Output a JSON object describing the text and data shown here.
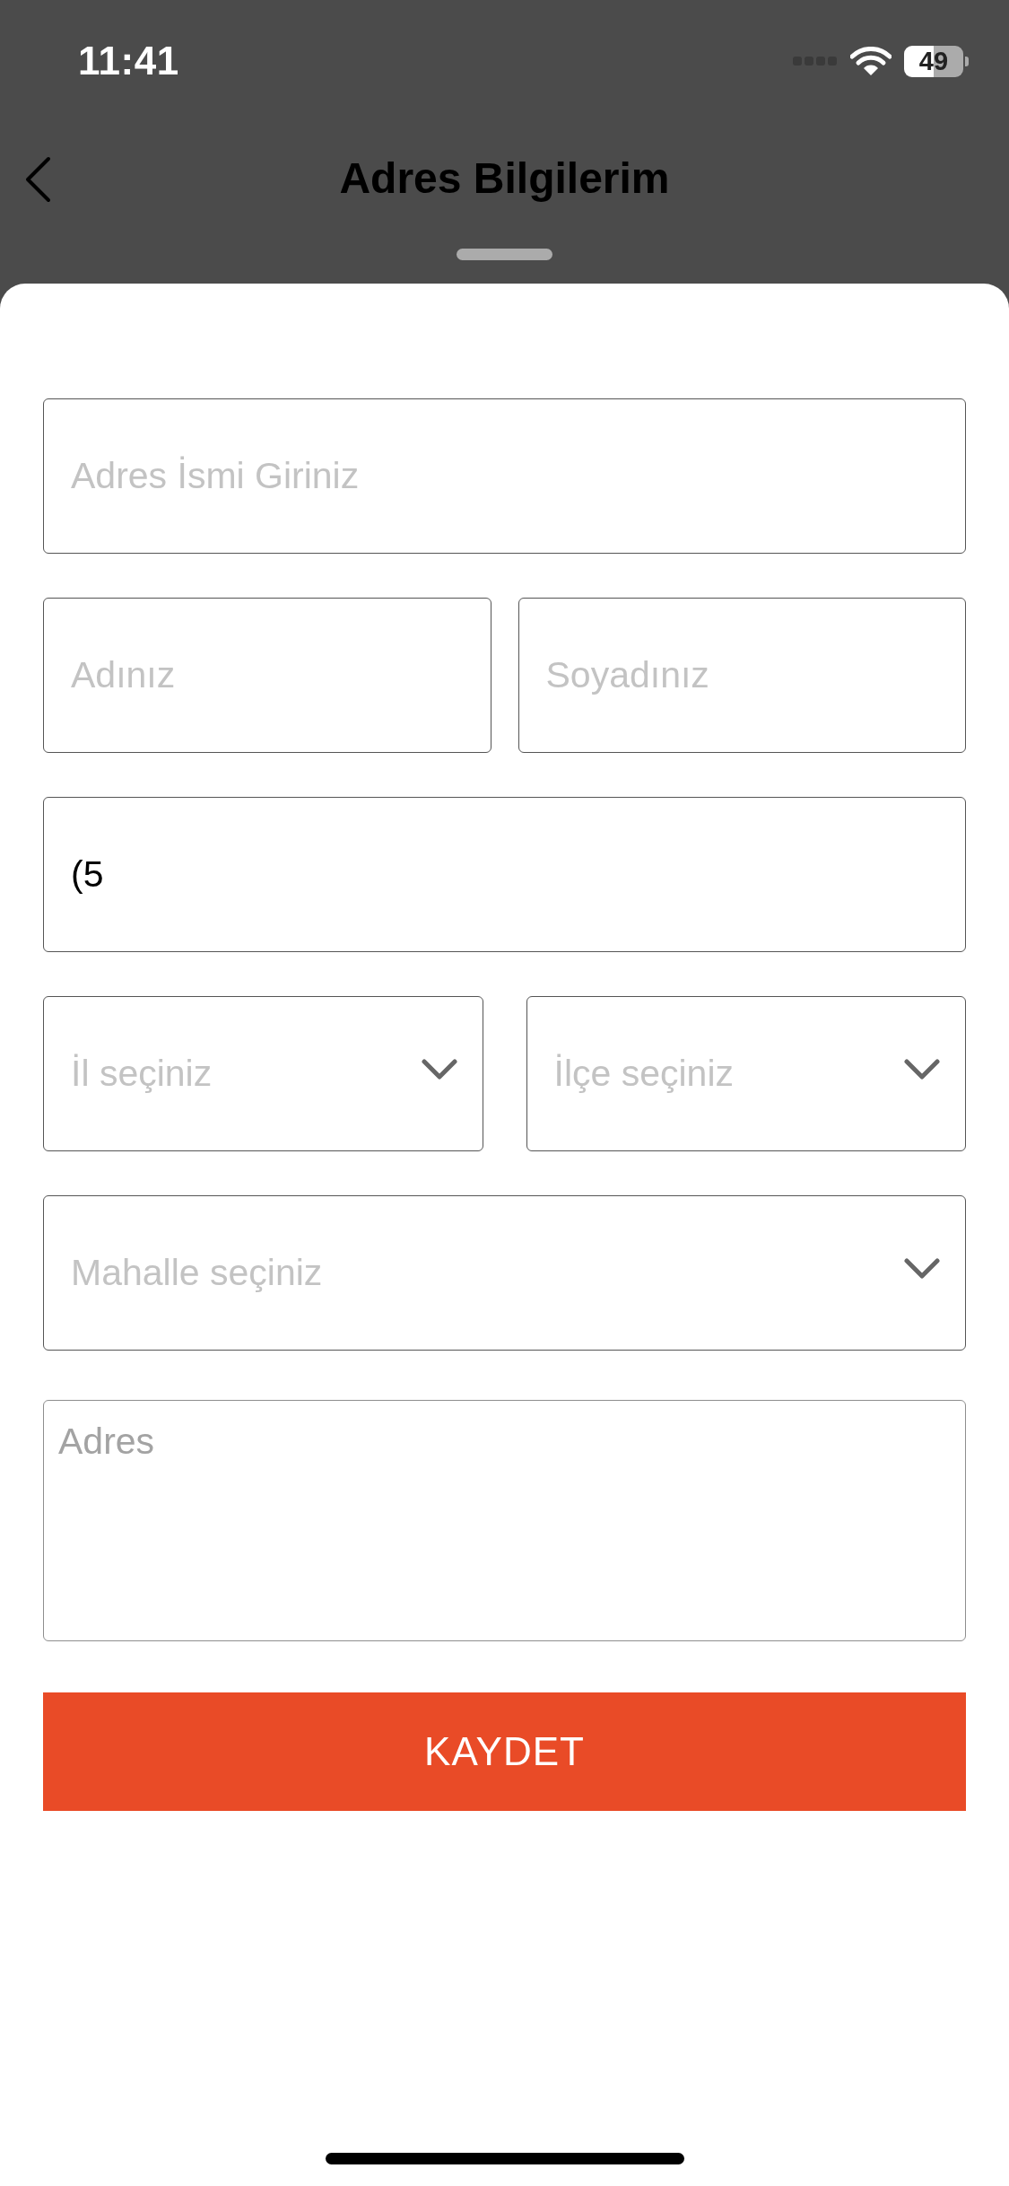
{
  "status_bar": {
    "time": "11:41",
    "battery": "49"
  },
  "header": {
    "title": "Adres Bilgilerim"
  },
  "form": {
    "rows": [
      [
        {
          "kind": "input",
          "placeholder": "Adres İsmi Giriniz"
        }
      ],
      [
        {
          "kind": "input",
          "placeholder": "Adınız"
        },
        {
          "kind": "input",
          "placeholder": "Soyadınız"
        }
      ],
      [
        {
          "kind": "input",
          "value": "(5"
        }
      ],
      [
        {
          "kind": "select",
          "placeholder": "İl seçiniz"
        },
        {
          "kind": "select",
          "placeholder": "İlçe seçiniz"
        }
      ],
      [
        {
          "kind": "select",
          "placeholder": "Mahalle seçiniz"
        }
      ],
      [
        {
          "kind": "textarea",
          "placeholder": "Adres"
        }
      ]
    ],
    "submit": {
      "label": "KAYDET"
    }
  }
}
